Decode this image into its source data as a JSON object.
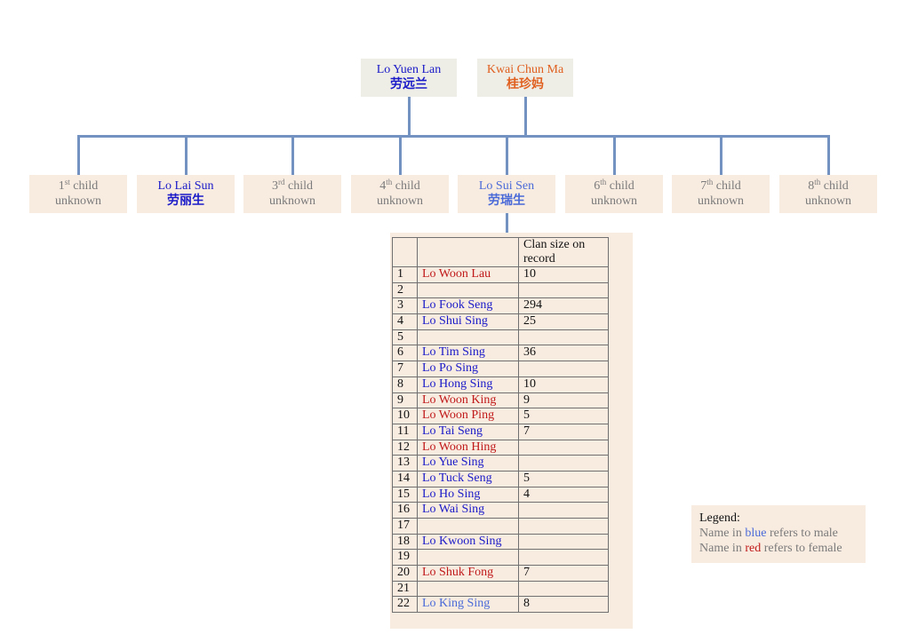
{
  "parents": [
    {
      "name": "Lo Yuen Lan",
      "chinese": "劳远兰",
      "color": "#1a1ac8"
    },
    {
      "name": "Kwai Chun Ma",
      "chinese": "桂珍妈",
      "color": "#e06020"
    }
  ],
  "children": [
    {
      "ordinal": "1",
      "suffix": "st",
      "label": "child",
      "status": "unknown"
    },
    {
      "name": "Lo Lai Sun",
      "chinese": "劳丽生"
    },
    {
      "ordinal": "3",
      "suffix": "rd",
      "label": "child",
      "status": "unknown"
    },
    {
      "ordinal": "4",
      "suffix": "th",
      "label": "child",
      "status": "unknown"
    },
    {
      "name": "Lo Sui Sen",
      "chinese": "劳瑞生"
    },
    {
      "ordinal": "6",
      "suffix": "th",
      "label": "child",
      "status": "unknown"
    },
    {
      "ordinal": "7",
      "suffix": "th",
      "label": "child",
      "status": "unknown"
    },
    {
      "ordinal": "8",
      "suffix": "th",
      "label": "child",
      "status": "unknown"
    }
  ],
  "table": {
    "header": [
      "",
      "",
      "Clan size on record"
    ],
    "rows": [
      {
        "n": "1",
        "name": "Lo Woon Lau",
        "gender": "female",
        "size": "10"
      },
      {
        "n": "2",
        "name": "",
        "gender": "",
        "size": ""
      },
      {
        "n": "3",
        "name": "Lo Fook Seng",
        "gender": "male",
        "size": "294"
      },
      {
        "n": "4",
        "name": "Lo Shui Sing",
        "gender": "male",
        "size": "25"
      },
      {
        "n": "5",
        "name": "",
        "gender": "",
        "size": ""
      },
      {
        "n": "6",
        "name": "Lo Tim Sing",
        "gender": "male",
        "size": "36"
      },
      {
        "n": "7",
        "name": "Lo Po Sing",
        "gender": "male",
        "size": ""
      },
      {
        "n": "8",
        "name": "Lo Hong Sing",
        "gender": "male",
        "size": "10"
      },
      {
        "n": "9",
        "name": "Lo Woon King",
        "gender": "female",
        "size": "9"
      },
      {
        "n": "10",
        "name": "Lo Woon Ping",
        "gender": "female",
        "size": "5"
      },
      {
        "n": "11",
        "name": "Lo Tai Seng",
        "gender": "male",
        "size": "7"
      },
      {
        "n": "12",
        "name": "Lo Woon Hing",
        "gender": "female",
        "size": ""
      },
      {
        "n": "13",
        "name": "Lo Yue Sing",
        "gender": "male",
        "size": ""
      },
      {
        "n": "14",
        "name": "Lo Tuck Seng",
        "gender": "male",
        "size": "5"
      },
      {
        "n": "15",
        "name": "Lo Ho Sing",
        "gender": "male",
        "size": "4"
      },
      {
        "n": "16",
        "name": "Lo Wai Sing",
        "gender": "male",
        "size": ""
      },
      {
        "n": "17",
        "name": "",
        "gender": "",
        "size": ""
      },
      {
        "n": "18",
        "name": "Lo Kwoon Sing",
        "gender": "male",
        "size": ""
      },
      {
        "n": "19",
        "name": "",
        "gender": "",
        "size": ""
      },
      {
        "n": "20",
        "name": "Lo Shuk Fong",
        "gender": "female",
        "size": "7"
      },
      {
        "n": "21",
        "name": "",
        "gender": "",
        "size": ""
      },
      {
        "n": "22",
        "name": "Lo King Sing",
        "gender": "male-light",
        "size": "8"
      }
    ]
  },
  "legend": {
    "title": "Legend:",
    "line1_pre": "Name in ",
    "line1_word": "blue",
    "line1_post": " refers to male",
    "line2_pre": "Name in ",
    "line2_word": "red",
    "line2_post": " refers to female"
  }
}
